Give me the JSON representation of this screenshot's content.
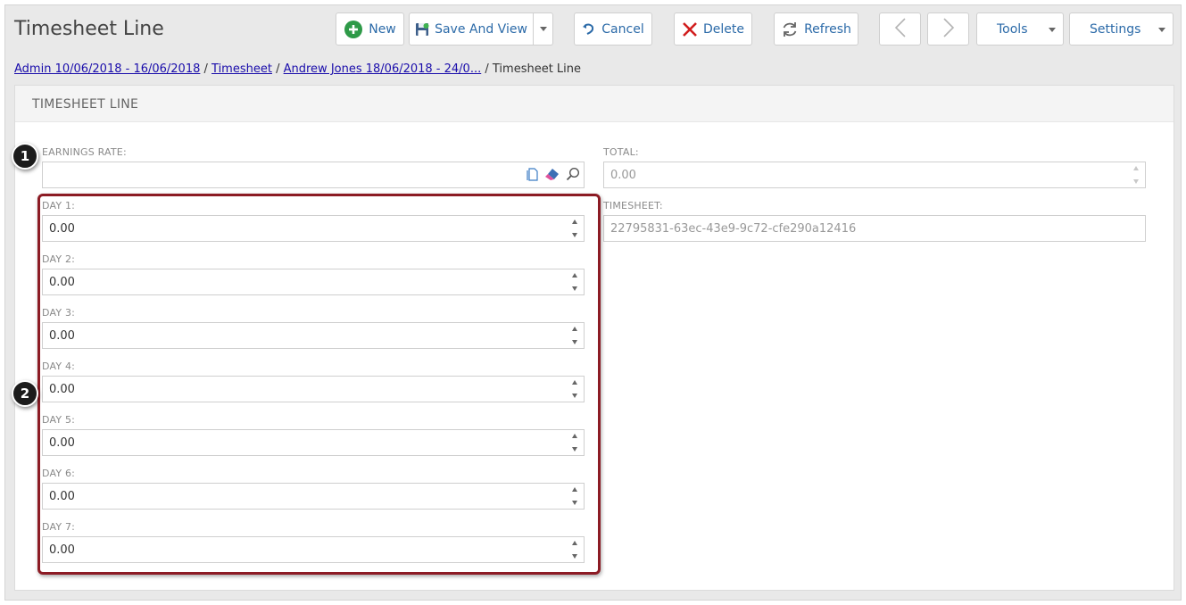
{
  "page": {
    "title": "Timesheet Line"
  },
  "toolbar": {
    "new_label": "New",
    "save_view_label": "Save And View",
    "cancel_label": "Cancel",
    "delete_label": "Delete",
    "refresh_label": "Refresh",
    "tools_label": "Tools",
    "settings_label": "Settings"
  },
  "breadcrumb": {
    "item1": "Admin 10/06/2018 - 16/06/2018",
    "sep1": " / ",
    "item2": "Timesheet",
    "sep2": " / ",
    "item3": "Andrew Jones 18/06/2018 - 24/0...",
    "sep3": " / ",
    "current": "Timesheet Line"
  },
  "panel": {
    "header": "TIMESHEET LINE"
  },
  "form": {
    "earnings_rate": {
      "label": "EARNINGS RATE:",
      "value": ""
    },
    "total": {
      "label": "TOTAL:",
      "value": "0.00"
    },
    "timesheet": {
      "label": "TIMESHEET:",
      "value": "22795831-63ec-43e9-9c72-cfe290a12416"
    },
    "days": [
      {
        "label": "DAY 1:",
        "value": "0.00"
      },
      {
        "label": "DAY 2:",
        "value": "0.00"
      },
      {
        "label": "DAY 3:",
        "value": "0.00"
      },
      {
        "label": "DAY 4:",
        "value": "0.00"
      },
      {
        "label": "DAY 5:",
        "value": "0.00"
      },
      {
        "label": "DAY 6:",
        "value": "0.00"
      },
      {
        "label": "DAY 7:",
        "value": "0.00"
      }
    ]
  },
  "callouts": {
    "one": "1",
    "two": "2"
  },
  "colors": {
    "accent": "#2b6aa8",
    "highlight": "#8c1b24",
    "new_icon": "#2e9a48",
    "delete_icon": "#d11d1d"
  },
  "icons": [
    "plus-circle-icon",
    "save-icon",
    "undo-icon",
    "x-icon",
    "refresh-icon",
    "chevron-left-icon",
    "chevron-right-icon",
    "copy-icon",
    "eraser-icon",
    "search-icon"
  ]
}
